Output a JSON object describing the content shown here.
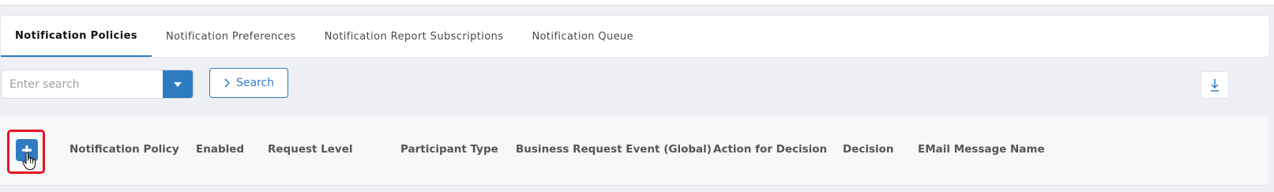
{
  "tabs": [
    {
      "label": "Notification Policies",
      "active": true
    },
    {
      "label": "Notification Preferences",
      "active": false
    },
    {
      "label": "Notification Report Subscriptions",
      "active": false
    },
    {
      "label": "Notification Queue",
      "active": false
    }
  ],
  "search": {
    "placeholder": "Enter search",
    "value": "",
    "button_label": "Search"
  },
  "table": {
    "columns": [
      "Notification Policy",
      "Enabled",
      "Request Level",
      "Participant Type",
      "Business Request Event (Global)",
      "Action for Decision",
      "Decision",
      "EMail Message Name"
    ]
  },
  "icons": {
    "dropdown": "caret-down-icon",
    "search_button": "chevron-right-icon",
    "download": "download-icon",
    "add": "plus-icon",
    "cursor": "hand-pointer-icon"
  },
  "colors": {
    "accent": "#2f7bc2",
    "highlight": "#e8141e"
  }
}
